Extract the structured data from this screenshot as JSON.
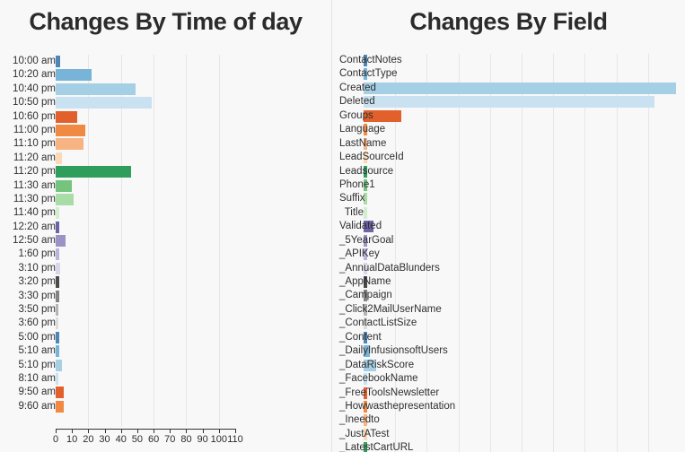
{
  "charts": [
    {
      "key": "time_of_day",
      "title": "Changes By Time of day"
    },
    {
      "key": "field",
      "title": "Changes By Field"
    }
  ],
  "chart_data": [
    {
      "type": "bar",
      "orientation": "horizontal",
      "title": "Changes By Time of day",
      "xlabel": "",
      "ylabel": "",
      "xlim": [
        0,
        110
      ],
      "xticks": [
        0,
        10,
        20,
        30,
        40,
        50,
        60,
        70,
        80,
        90,
        100,
        110
      ],
      "grid": true,
      "gridlines_at": [
        20,
        40,
        60,
        80,
        100
      ],
      "axis_visible": true,
      "legend": "none",
      "categories": [
        "10:00 am",
        "10:20 am",
        "10:40 pm",
        "10:50 pm",
        "10:60 pm",
        "11:00 pm",
        "11:10 pm",
        "11:20 am",
        "11:20 pm",
        "11:30 am",
        "11:30 pm",
        "11:40 pm",
        "12:20 am",
        "12:50 am",
        "1:60 pm",
        "3:10 pm",
        "3:20 pm",
        "3:30 pm",
        "3:50 pm",
        "3:60 pm",
        "5:00 pm",
        "5:10 am",
        "5:10 pm",
        "8:10 am",
        "9:50 am",
        "9:60 am"
      ],
      "values": [
        3,
        22,
        49,
        59,
        13,
        18,
        17,
        4,
        46,
        10,
        11,
        2,
        2,
        6,
        2,
        3,
        2,
        2,
        1,
        1,
        2,
        2,
        4,
        1,
        5,
        5
      ],
      "colors": [
        "#4d87b8",
        "#78b4d8",
        "#a5cfe5",
        "#c9e1f0",
        "#e2602c",
        "#f08a42",
        "#f7b381",
        "#fbd9b7",
        "#2f9e5c",
        "#74c47e",
        "#a9dda7",
        "#d3eecb",
        "#6f63a8",
        "#9b93c6",
        "#b9b4dc",
        "#d9d6ec",
        "#4a4a4a",
        "#838383",
        "#b5b5b5",
        "#dcdcdc",
        "#4d87b8",
        "#78b4d8",
        "#a5cfe5",
        "#c9e1f0",
        "#e2602c",
        "#f08a42"
      ]
    },
    {
      "type": "bar",
      "orientation": "horizontal",
      "title": "Changes By Field",
      "xlabel": "",
      "ylabel": "",
      "xlim": [
        0,
        100
      ],
      "grid": true,
      "gridlines_at": [
        10,
        20,
        30,
        40,
        50,
        60,
        70,
        80,
        90
      ],
      "axis_visible": false,
      "legend": "none",
      "categories": [
        "ContactNotes",
        "ContactType",
        "Created",
        "Deleted",
        "Groups",
        "Language",
        "LastName",
        "LeadSourceId",
        "Leadsource",
        "Phone1",
        "Suffix",
        "Title",
        "Validated",
        "_5YearGoal",
        "_APIKey",
        "_AnnualDataBlunders",
        "_AppName",
        "_Campaign",
        "_Click2MailUserName",
        "_ContactListSize",
        "_Content",
        "_DailyInfusionsoftUsers",
        "_DataRiskScore",
        "_FacebookName",
        "_FreeToolsNewsletter",
        "_Howwasthepresentation",
        "_Ineedto",
        "_JustATest",
        "_LatestCartURL"
      ],
      "values": [
        1,
        1,
        99,
        92,
        12,
        1,
        1,
        1,
        1,
        1,
        1,
        1,
        3,
        1,
        1,
        1,
        1,
        1,
        1,
        1,
        1,
        2,
        4,
        1,
        1,
        1,
        1,
        1,
        1
      ],
      "colors": [
        "#4d87b8",
        "#78b4d8",
        "#a5cfe5",
        "#c9e1f0",
        "#e2602c",
        "#f08a42",
        "#f7b381",
        "#fbd9b7",
        "#2f9e5c",
        "#74c47e",
        "#a9dda7",
        "#d3eecb",
        "#6f63a8",
        "#9b93c6",
        "#b9b4dc",
        "#d9d6ec",
        "#4a4a4a",
        "#838383",
        "#b5b5b5",
        "#dcdcdc",
        "#4d87b8",
        "#78b4d8",
        "#a5cfe5",
        "#c9e1f0",
        "#e2602c",
        "#f08a42",
        "#f7b381",
        "#fbd9b7",
        "#2f9e5c"
      ]
    }
  ]
}
